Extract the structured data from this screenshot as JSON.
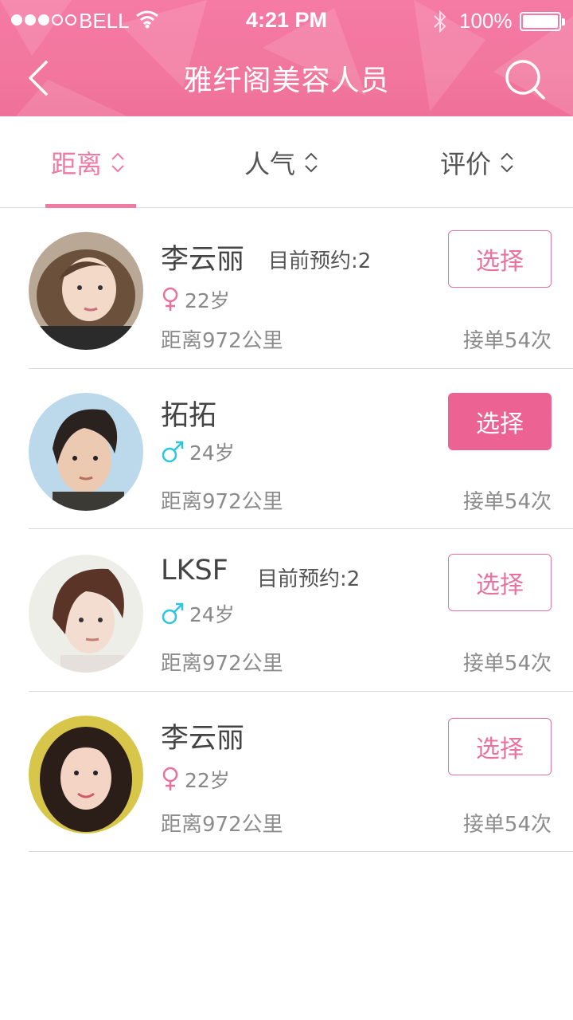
{
  "status_bar": {
    "carrier": "BELL",
    "time": "4:21 PM",
    "battery": "100%"
  },
  "header": {
    "title": "雅纤阁美容人员",
    "back_icon": "chevron-left-icon",
    "search_icon": "search-icon"
  },
  "tabs": [
    {
      "label": "距离",
      "active": true
    },
    {
      "label": "人气",
      "active": false
    },
    {
      "label": "评价",
      "active": false
    }
  ],
  "colors": {
    "accent": "#f07aa2",
    "female": "#e8729c",
    "male": "#29c6e3"
  },
  "staff": [
    {
      "name": "李云丽",
      "appointments": "目前预约:2",
      "gender_icon": "female-icon",
      "age": "22岁",
      "distance": "距离972公里",
      "orders": "接单54次",
      "button": "选择",
      "selected": false
    },
    {
      "name": "拓拓",
      "appointments": "",
      "gender_icon": "male-icon",
      "age": "24岁",
      "distance": "距离972公里",
      "orders": "接单54次",
      "button": "选择",
      "selected": true
    },
    {
      "name": "LKSF",
      "appointments": "目前预约:2",
      "gender_icon": "male-icon",
      "age": "24岁",
      "distance": "距离972公里",
      "orders": "接单54次",
      "button": "选择",
      "selected": false
    },
    {
      "name": "李云丽",
      "appointments": "",
      "gender_icon": "female-icon",
      "age": "22岁",
      "distance": "距离972公里",
      "orders": "接单54次",
      "button": "选择",
      "selected": false
    }
  ]
}
